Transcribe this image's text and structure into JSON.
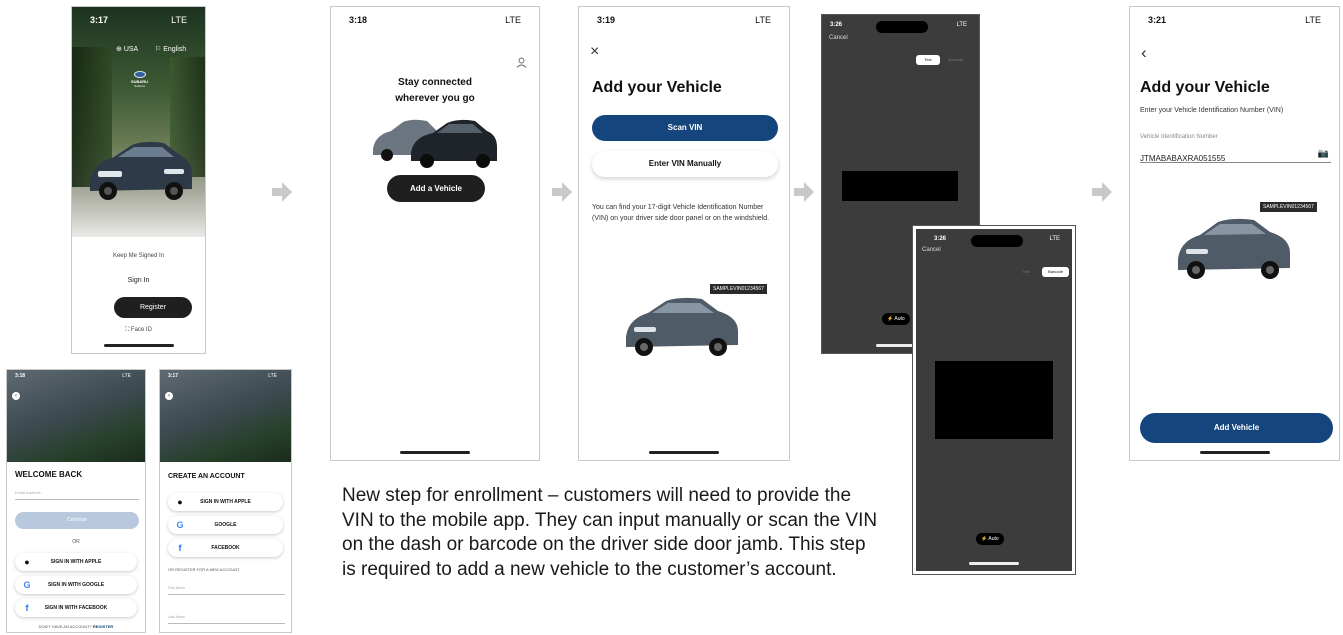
{
  "colors": {
    "brand_blue": "#15457d",
    "dark_button": "#1f1f1f",
    "scanner_bg": "#3c3c3c"
  },
  "status": {
    "s1_time": "3:17",
    "s2_time": "3:18",
    "s3_time": "3:19",
    "s4_time": "3:26",
    "s5_time": "3:26",
    "s6_time": "3:21",
    "s7_time": "3:18",
    "s8_time": "3:17",
    "carrier": "LTE"
  },
  "splash": {
    "region": "USA",
    "language": "English",
    "brand": "SUBARU",
    "brand_sub": "Solterra",
    "keep_signed_in": "Keep Me Signed In",
    "sign_in": "Sign In",
    "register": "Register",
    "face_id": "Face ID"
  },
  "connect": {
    "title_line1": "Stay connected",
    "title_line2": "wherever you go",
    "add_button": "Add a Vehicle"
  },
  "add_vehicle": {
    "close": "×",
    "title": "Add your Vehicle",
    "scan_button": "Scan VIN",
    "manual_button": "Enter VIN Manually",
    "help_text": "You can find your 17-digit Vehicle Identification Number (VIN) on your driver side door panel or on the windshield.",
    "vin_tag": "SAMPLEVIN01234567"
  },
  "scan_text": {
    "cancel": "Cancel",
    "seg_text": "Text",
    "seg_barcode": "Barcode",
    "auto": "Auto"
  },
  "scan_barcode": {
    "cancel": "Cancel",
    "seg_text": "Text",
    "seg_barcode": "Barcode",
    "auto": "Auto"
  },
  "manual_entry": {
    "back": "‹",
    "title": "Add your Vehicle",
    "subtitle": "Enter your Vehicle Identification Number (VIN)",
    "field_label": "Vehicle Identification Number",
    "field_value": "JTMABABAXRA051555",
    "vin_tag": "SAMPLEVIN01234567",
    "submit": "Add Vehicle"
  },
  "welcome": {
    "title": "WELCOME BACK",
    "email_placeholder": "Email Address",
    "continue": "Continue",
    "or": "OR",
    "apple": "SIGN IN WITH APPLE",
    "google": "SIGN IN WITH GOOGLE",
    "facebook": "SIGN IN WITH FACEBOOK",
    "footer_q": "DON'T HAVE AN ACCOUNT?",
    "footer_link": "REGISTER"
  },
  "create": {
    "title": "CREATE AN ACCOUNT",
    "apple": "SIGN IN WITH APPLE",
    "google": "GOOGLE",
    "facebook": "FACEBOOK",
    "or_register": "OR REGISTER FOR A NEW ACCOUNT",
    "first_name": "First Name",
    "last_name": "Last Name"
  },
  "caption": "New step for enrollment – customers will need to provide the VIN to the mobile app. They can input manually or scan the VIN on the dash or barcode on the driver side door jamb. This step is required to add a new vehicle to the customer’s account."
}
